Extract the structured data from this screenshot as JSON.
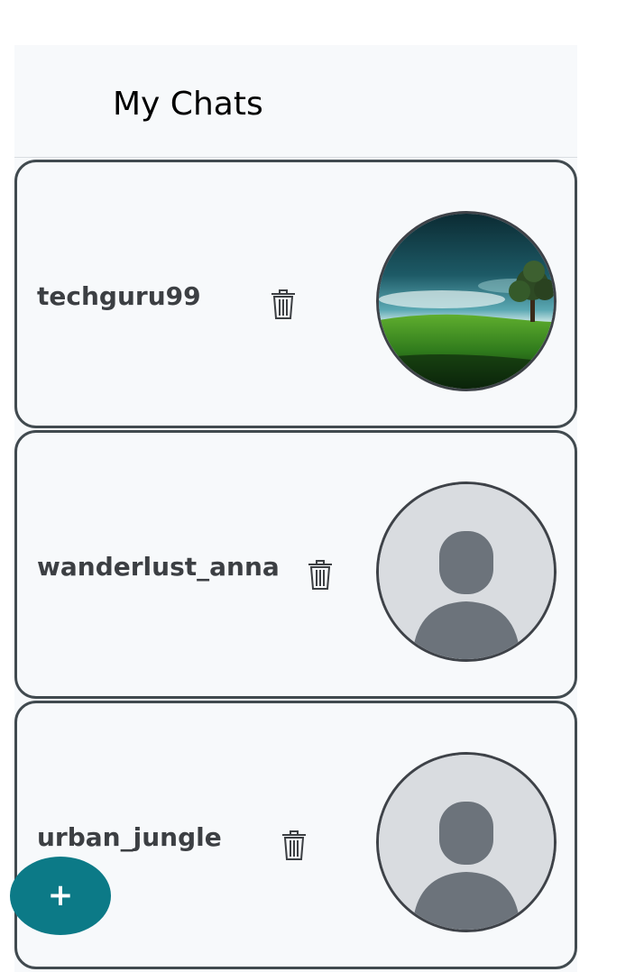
{
  "header": {
    "title": "My Chats"
  },
  "chats": [
    {
      "name": "techguru99",
      "avatar": "landscape-photo"
    },
    {
      "name": "wanderlust_anna",
      "avatar": "default-person-icon"
    },
    {
      "name": "urban_jungle",
      "avatar": "default-person-icon"
    }
  ],
  "fab": {
    "label": "+"
  },
  "colors": {
    "card_border": "#414a4f",
    "card_background": "#f7f9fb",
    "fab": "#0c7a87",
    "avatar_placeholder_bg": "#d9dce0",
    "avatar_placeholder_fg": "#6c737b"
  }
}
